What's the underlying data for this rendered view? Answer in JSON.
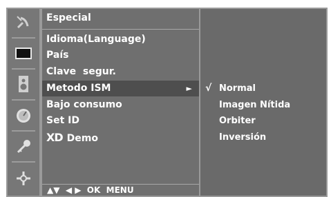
{
  "menu": {
    "title": "Especial",
    "items": [
      {
        "label": "Idioma(Language)"
      },
      {
        "label": "País"
      },
      {
        "label": "Clave  segur."
      },
      {
        "label": "Metodo ISM",
        "selected": true,
        "arrow": "►"
      },
      {
        "label": "Bajo consumo"
      },
      {
        "label": "Set ID"
      },
      {
        "logo": "XD",
        "label": "Demo"
      }
    ],
    "footer": "▲▼  ◀ ▶  OK  MENU"
  },
  "submenu": {
    "check_mark": "√",
    "options": [
      {
        "label": "Normal",
        "checked": true
      },
      {
        "label": "Imagen Nítida"
      },
      {
        "label": "Orbiter"
      },
      {
        "label": "Inversión"
      }
    ]
  },
  "iconbar": {
    "icons": [
      "satellite-dish-icon",
      "screen-icon",
      "speaker-icon",
      "clock-icon",
      "key-icon",
      "joystick-icon"
    ]
  },
  "colors": {
    "outer": "#9a9a9a",
    "iconbar": "#777777",
    "menu_bg": "#6f6f6f",
    "selected_bg": "#4e4e4e",
    "submenu_bg": "#6a6a6a",
    "text": "#ffffff"
  }
}
